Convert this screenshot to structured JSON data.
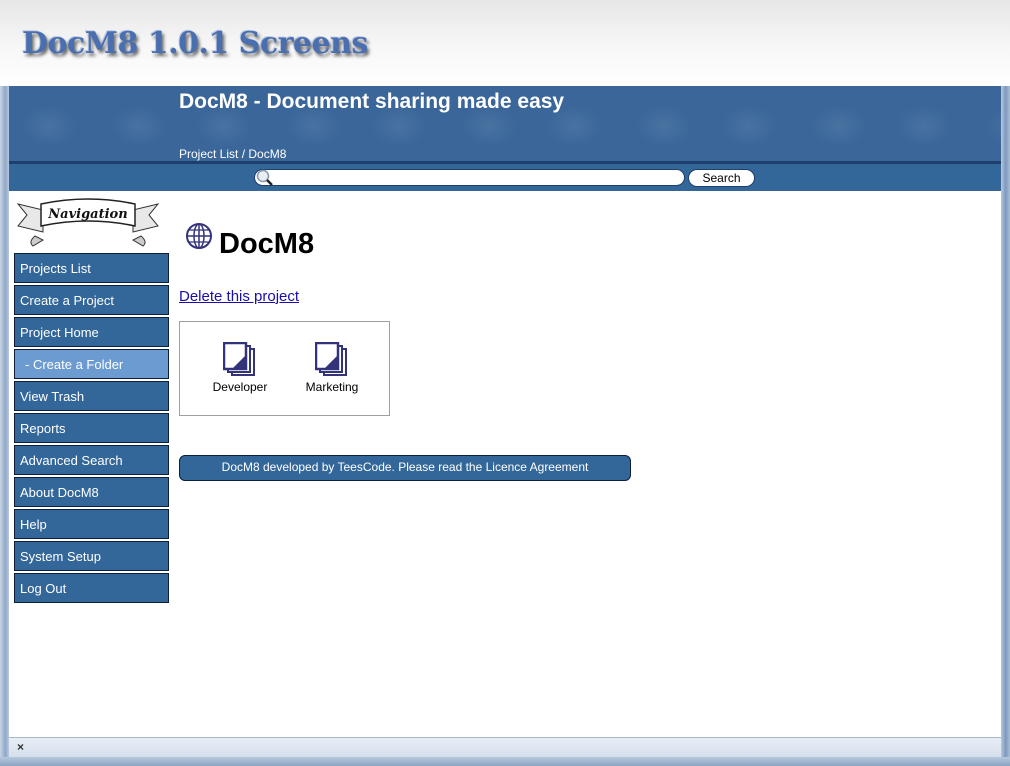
{
  "banner": {
    "title": "DocM8 1.0.1 Screens"
  },
  "header": {
    "title": "DocM8 - Document sharing made easy",
    "breadcrumb": "Project List / DocM8"
  },
  "search": {
    "placeholder": "",
    "value": "",
    "button_label": "Search"
  },
  "nav": {
    "banner_label": "Navigation",
    "items": [
      {
        "label": "Projects List"
      },
      {
        "label": "Create a Project"
      },
      {
        "label": "Project Home"
      },
      {
        "label": "- Create a Folder"
      },
      {
        "label": "View Trash"
      },
      {
        "label": "Reports"
      },
      {
        "label": "Advanced Search"
      },
      {
        "label": "About DocM8"
      },
      {
        "label": "Help"
      },
      {
        "label": "System Setup"
      },
      {
        "label": "Log Out"
      }
    ]
  },
  "project": {
    "title": "DocM8",
    "delete_link": "Delete this project",
    "folders": [
      {
        "label": "Developer"
      },
      {
        "label": "Marketing"
      }
    ]
  },
  "footer": {
    "text": "DocM8 developed by TeesCode. Please read the Licence Agreement"
  },
  "status_bar": {
    "close_glyph": "×"
  },
  "colors": {
    "primary": "#336699",
    "sub_nav": "#6b9bd1",
    "link": "#1a0dab",
    "folder_icon": "#33337a"
  }
}
